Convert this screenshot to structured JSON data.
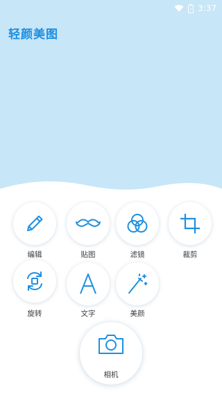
{
  "status_bar": {
    "time": "3:37"
  },
  "app": {
    "title": "轻颜美图"
  },
  "tools": [
    {
      "label": "编辑",
      "icon": "pencil-icon"
    },
    {
      "label": "贴图",
      "icon": "mustache-icon"
    },
    {
      "label": "滤镜",
      "icon": "filter-circles-icon"
    },
    {
      "label": "裁剪",
      "icon": "crop-icon"
    },
    {
      "label": "旋转",
      "icon": "rotate-icon"
    },
    {
      "label": "文字",
      "icon": "letter-a-icon"
    },
    {
      "label": "美颜",
      "icon": "magic-wand-icon"
    }
  ],
  "camera": {
    "label": "相机",
    "icon": "camera-icon"
  },
  "colors": {
    "accent": "#1d8fe0",
    "hero_background": "#c7e6f8"
  }
}
